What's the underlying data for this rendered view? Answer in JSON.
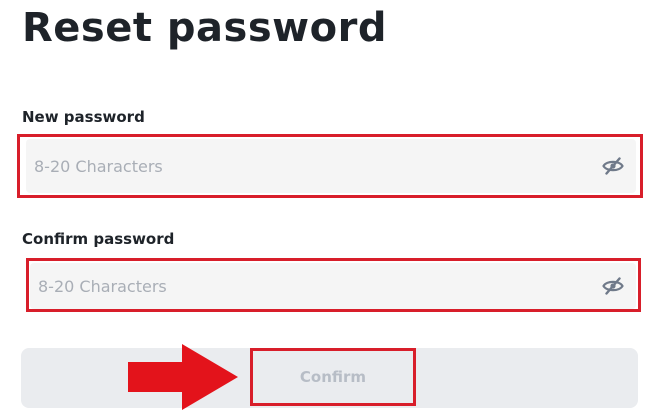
{
  "page": {
    "title": "Reset password"
  },
  "form": {
    "new_password": {
      "label": "New password",
      "placeholder": "8-20 Characters",
      "value": "",
      "icon": "eye-slash-icon"
    },
    "confirm_password": {
      "label": "Confirm password",
      "placeholder": "8-20 Characters",
      "value": "",
      "icon": "eye-slash-icon"
    },
    "submit": {
      "label": "Confirm"
    }
  },
  "colors": {
    "text": "#1e2329",
    "placeholder": "#a9aeb6",
    "input_bg": "#f5f5f5",
    "button_bg": "#eaecef",
    "button_text_disabled": "#b7bdc6",
    "annotation_red": "#d81e2a"
  }
}
